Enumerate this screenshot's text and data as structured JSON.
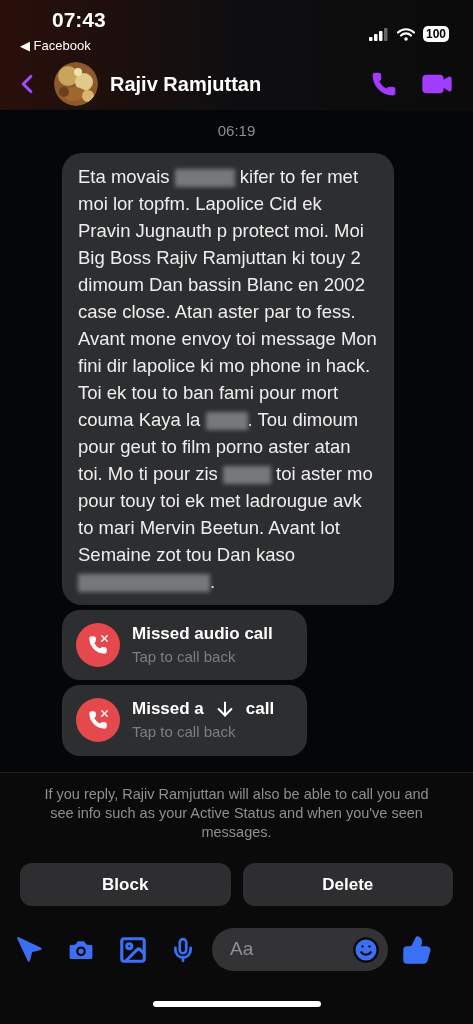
{
  "status_bar": {
    "time": "07:43",
    "back_app": "◀ Facebook",
    "battery": "100"
  },
  "header": {
    "contact_name": "Rajiv Ramjuttan"
  },
  "timestamp": "06:19",
  "message": {
    "segments": [
      {
        "kind": "text",
        "text": "Eta movais "
      },
      {
        "kind": "redacted"
      },
      {
        "kind": "text",
        "text": " kifer to fer met moi lor topfm. Lapolice  Cid ek Pravin Jugnauth p protect moi. Moi Big Boss Rajiv Ramjuttan ki touy 2 dimoum Dan bassin Blanc en 2002 case close. Atan aster par to fess. Avant mone envoy toi message Mon fini dir lapolice ki mo phone in hack. Toi ek tou to ban fami pour mort couma Kaya la "
      },
      {
        "kind": "redacted"
      },
      {
        "kind": "text",
        "text": ". Tou dimoum pour geut to film porno aster atan toi. Mo ti pour zis "
      },
      {
        "kind": "redacted"
      },
      {
        "kind": "text",
        "text": " toi aster mo pour touy toi ek met ladrougue avk to mari Mervin Beetun. Avant lot Semaine zot tou Dan kaso"
      },
      {
        "kind": "redacted"
      },
      {
        "kind": "text",
        "text": "."
      }
    ]
  },
  "calls": [
    {
      "title_parts": [
        "Missed audio call"
      ],
      "subtitle": "Tap to call back"
    },
    {
      "title_parts": [
        "Missed a",
        "call"
      ],
      "subtitle": "Tap to call back"
    }
  ],
  "notice": "If you reply, Rajiv Ramjuttan will also be able to call you and see info such as your Active Status and when you've seen messages.",
  "actions": [
    "Block",
    "Delete"
  ],
  "composer": {
    "placeholder": "Aa"
  }
}
